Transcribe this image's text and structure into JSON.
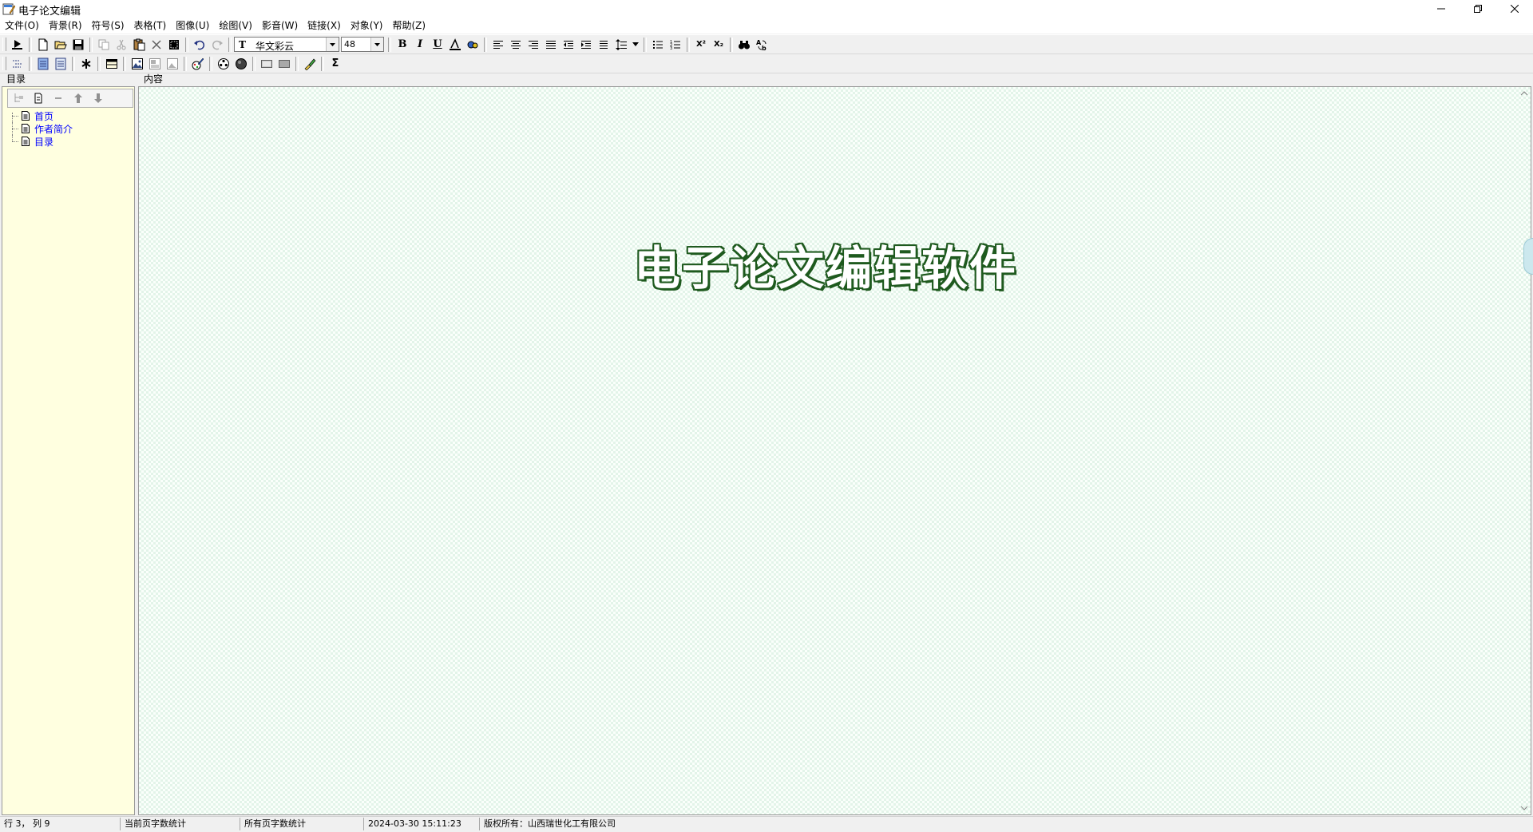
{
  "window": {
    "title": "电子论文编辑",
    "minimize": "minimize",
    "restore": "restore",
    "close": "close"
  },
  "menu": [
    {
      "label": "文件(O)"
    },
    {
      "label": "背景(R)"
    },
    {
      "label": "符号(S)"
    },
    {
      "label": "表格(T)"
    },
    {
      "label": "图像(U)"
    },
    {
      "label": "绘图(V)"
    },
    {
      "label": "影音(W)"
    },
    {
      "label": "链接(X)"
    },
    {
      "label": "对象(Y)"
    },
    {
      "label": "帮助(Z)"
    }
  ],
  "format_toolbar": {
    "font": "华文彩云",
    "font_icon": "T",
    "size": "48",
    "bold_label": "B",
    "italic_label": "I",
    "underline_label": "U",
    "superscript_label": "X²",
    "subscript_label": "X₂"
  },
  "insert_toolbar": {
    "sigma_label": "Σ"
  },
  "directory": {
    "label": "目录",
    "items": [
      {
        "label": "首页"
      },
      {
        "label": "作者简介"
      },
      {
        "label": "目录"
      }
    ]
  },
  "content": {
    "label": "内容",
    "title_text": "电子论文编辑软件",
    "title_color": "#1f5a1f",
    "background_color": "#e3f4e9"
  },
  "status": {
    "position": "行 3， 列 9",
    "current_page_count": "当前页字数统计",
    "all_pages_count": "所有页字数统计",
    "datetime": "2024-03-30 15:11:23",
    "copyright": "版权所有：山西瑞世化工有限公司"
  },
  "colors": {
    "tree_link": "#0000ff",
    "directory_bg": "#ffffe0"
  }
}
